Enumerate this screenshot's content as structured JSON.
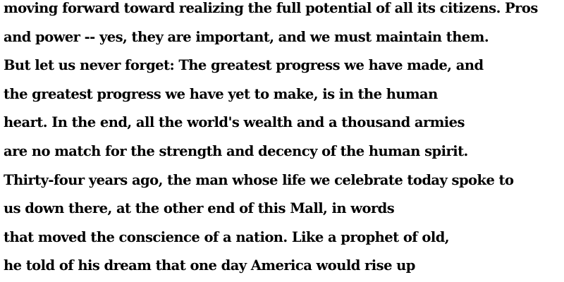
{
  "document": {
    "lines": [
      "moving forward toward realizing the full potential of all its citizens. Pros",
      "and power -- yes, they are important, and we must maintain them.",
      "But let us never forget: The greatest progress we have made, and",
      "the greatest progress we have yet to make, is in the human",
      "heart. In the end, all the world's wealth and a thousand armies",
      "are no match for the strength and decency of the human spirit.",
      "Thirty-four years ago, the man whose life we celebrate today spoke to",
      "us down there, at the other end of this Mall, in words",
      "that moved the conscience of a nation. Like a prophet of old,",
      "he told of his dream that one day America would rise up"
    ]
  }
}
